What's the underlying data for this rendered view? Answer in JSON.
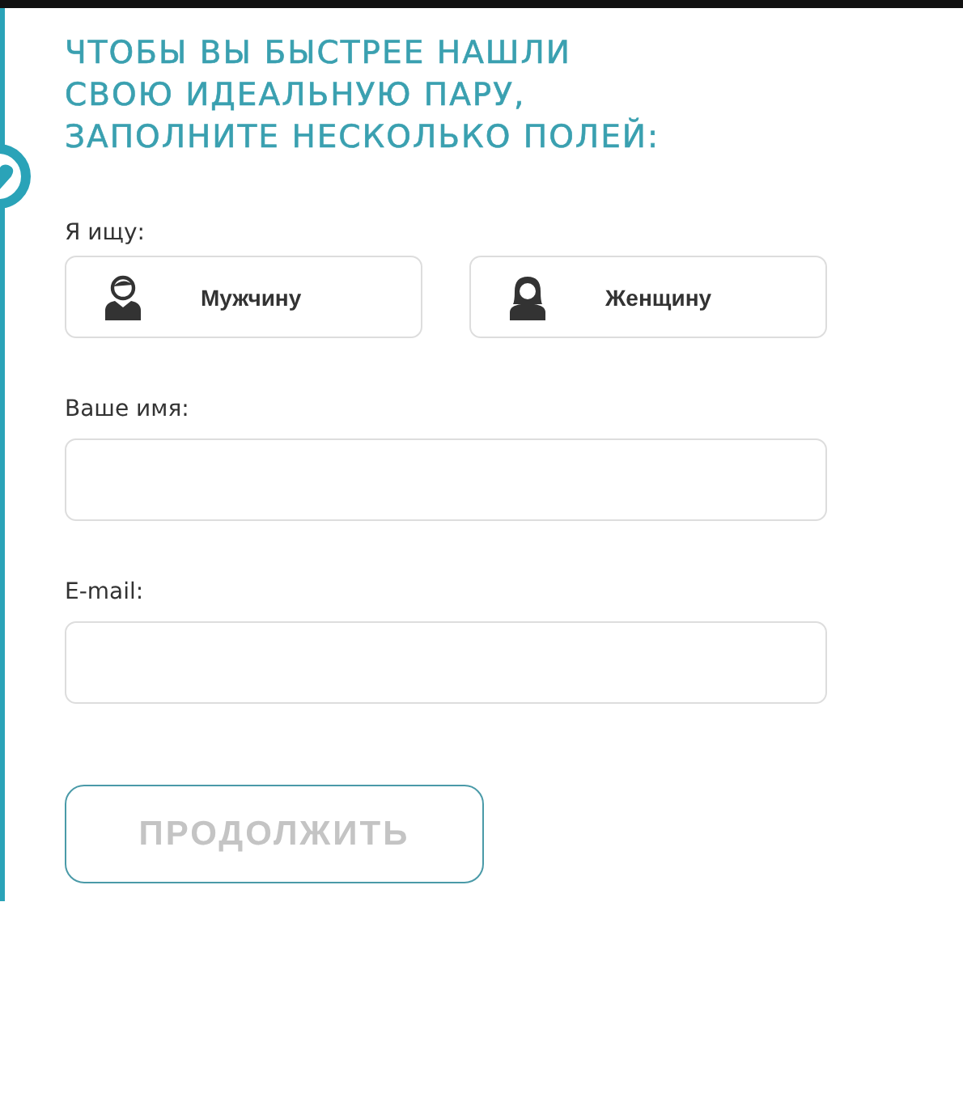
{
  "heading": [
    "ЧТОБЫ ВЫ БЫСТРЕЕ НАШЛИ",
    "СВОЮ ИДЕАЛЬНУЮ ПАРУ,",
    "ЗАПОЛНИТЕ НЕСКОЛЬКО ПОЛЕЙ:"
  ],
  "seeking": {
    "label": "Я ищу:",
    "options": [
      {
        "kind": "man",
        "label": "Мужчину",
        "selected": false
      },
      {
        "kind": "woman",
        "label": "Женщину",
        "selected": false
      }
    ]
  },
  "fields": [
    {
      "label": "Ваше имя:"
    },
    {
      "label": "E-mail:"
    }
  ],
  "continue_button": {
    "label": "ПРОДОЛЖИТЬ",
    "disabled": true
  }
}
